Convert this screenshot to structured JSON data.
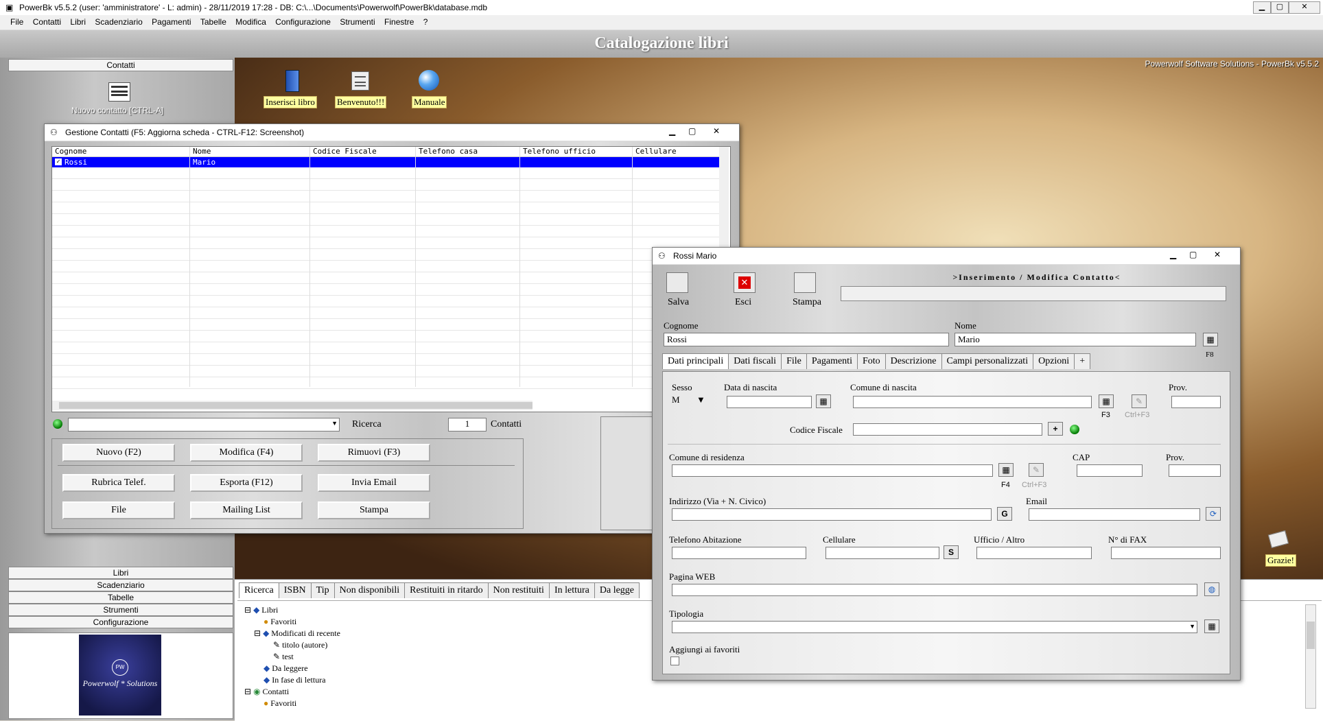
{
  "app": {
    "title": "PowerBk v5.5.2  (user: 'amministratore'  - L: admin) - 28/11/2019 17:28 - DB: C:\\...\\Documents\\Powerwolf\\PowerBk\\database.mdb",
    "header": "Catalogazione libri",
    "brand": "Powerwolf Software Solutions - PowerBk v5.5.2"
  },
  "menu": [
    "File",
    "Contatti",
    "Libri",
    "Scadenziario",
    "Pagamenti",
    "Tabelle",
    "Modifica",
    "Configurazione",
    "Strumenti",
    "Finestre",
    "?"
  ],
  "left": {
    "top_section": "Contatti",
    "new_contact": "Nuovo contatto [CTRL-A]",
    "sections": [
      "Libri",
      "Scadenziario",
      "Tabelle",
      "Strumenti",
      "Configurazione"
    ],
    "logo_text": "Powerwolf * Solutions",
    "logo_mark": "PW"
  },
  "desktop": {
    "shortcuts": [
      "Inserisci libro",
      "Benvenuto!!!",
      "Manuale"
    ],
    "thanks": "Grazie!"
  },
  "contacts_window": {
    "title": "Gestione Contatti (F5: Aggiorna scheda - CTRL-F12: Screenshot)",
    "columns": [
      "Cognome",
      "Nome",
      "Codice Fiscale",
      "Telefono casa",
      "Telefono ufficio",
      "Cellulare"
    ],
    "rows": [
      [
        "Rossi",
        "Mario",
        "",
        "",
        "",
        ""
      ]
    ],
    "search_label": "Ricerca",
    "count": "1",
    "count_label": "Contatti",
    "buttons": [
      "Nuovo (F2)",
      "Modifica (F4)",
      "Rimuovi (F3)",
      "Rubrica Telef.",
      "Esporta  (F12)",
      "Invia Email",
      "File",
      "Mailing List",
      "Stampa"
    ]
  },
  "bottom": {
    "tabs": [
      "Ricerca",
      "ISBN",
      "Tip",
      "Non disponibili",
      "Restituiti in ritardo",
      "Non restituiti",
      "In lettura",
      "Da legge"
    ],
    "tree": [
      "Libri",
      "Favoriti",
      "Modificati di recente",
      "titolo (autore)",
      "test",
      "Da leggere",
      "In fase di lettura",
      "Contatti",
      "Favoriti"
    ]
  },
  "detail": {
    "title": "Rossi Mario",
    "heading": ">Inserimento / Modifica  Contatto<",
    "toolbar": [
      "Salva",
      "Esci",
      "Stampa"
    ],
    "cognome_label": "Cognome",
    "cognome": "Rossi",
    "nome_label": "Nome",
    "nome": "Mario",
    "f8": "F8",
    "tabs": [
      "Dati principali",
      "Dati fiscali",
      "File",
      "Pagamenti",
      "Foto",
      "Descrizione",
      "Campi personalizzati",
      "Opzioni",
      "+"
    ],
    "sesso_label": "Sesso",
    "sesso": "M",
    "data_nascita_label": "Data di nascita",
    "comune_nascita_label": "Comune di nascita",
    "f3": "F3",
    "ctrl_f3": "Ctrl+F3",
    "prov_label": "Prov.",
    "cf_label": "Codice Fiscale",
    "cf_plus": "+",
    "comune_res_label": "Comune di residenza",
    "f4": "F4",
    "cap_label": "CAP",
    "indirizzo_label": "Indirizzo (Via + N. Civico)",
    "g_btn": "G",
    "email_label": "Email",
    "tel_ab_label": "Telefono Abitazione",
    "cell_label": "Cellulare",
    "s_btn": "S",
    "ufficio_label": "Ufficio / Altro",
    "fax_label": "N° di FAX",
    "web_label": "Pagina WEB",
    "tipologia_label": "Tipologia",
    "fav_label": "Aggiungi ai favoriti"
  },
  "colors": {
    "selection": "#0000ff",
    "accent": "#2060c0"
  }
}
